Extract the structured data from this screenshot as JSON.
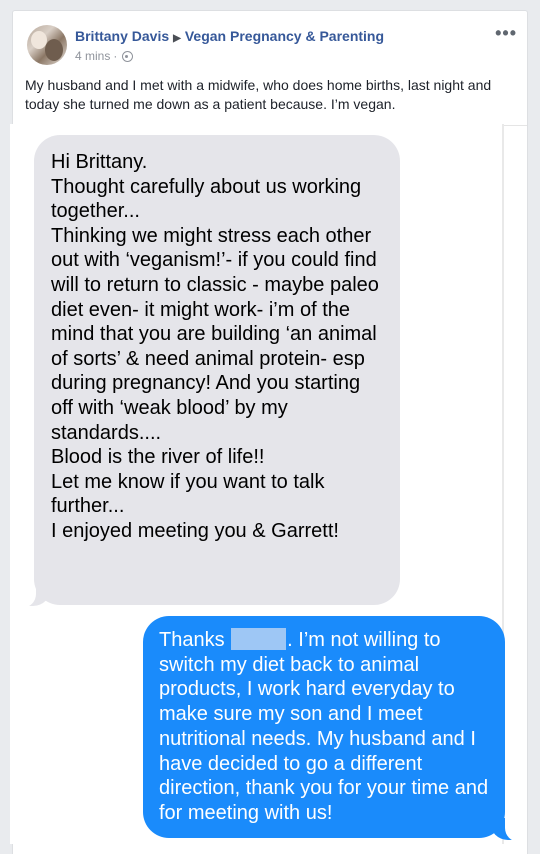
{
  "post": {
    "author": "Brittany Davis",
    "group": "Vegan Pregnancy & Parenting",
    "time": "4 mins",
    "separator": "·",
    "more_label": "•••",
    "text": "My husband and I met with a midwife, who does home births, last night and today she turned me down as a patient because. I’m vegan."
  },
  "messages": {
    "incoming": "Hi Brittany.\nThought carefully about us working together...\nThinking we might stress each other out with ‘veganism!’- if you could find will to return to classic - maybe paleo diet even- it might work- i’m of the mind that you are building ‘an animal of sorts’ & need animal protein- esp during pregnancy! And you starting off with ‘weak blood’ by my standards....\nBlood is the river of life!!\nLet me know if you want to talk further...\nI enjoyed meeting you & Garrett!",
    "outgoing_start": "Thanks",
    "outgoing_rest": ". I’m not willing to switch my diet back to animal products, I work hard everyday to make sure my son and I meet nutritional needs. My husband and I have decided to go a different direction, thank you for your time and for meeting with us!"
  },
  "colors": {
    "link": "#365899",
    "incoming_bubble": "#e5e5ea",
    "outgoing_bubble": "#1a8bfb",
    "redaction": "#9ec7f5"
  },
  "icons": {
    "avatar": "profile-photo",
    "arrow": "triangle-right-icon",
    "audience": "globe-icon",
    "menu": "more-icon"
  }
}
